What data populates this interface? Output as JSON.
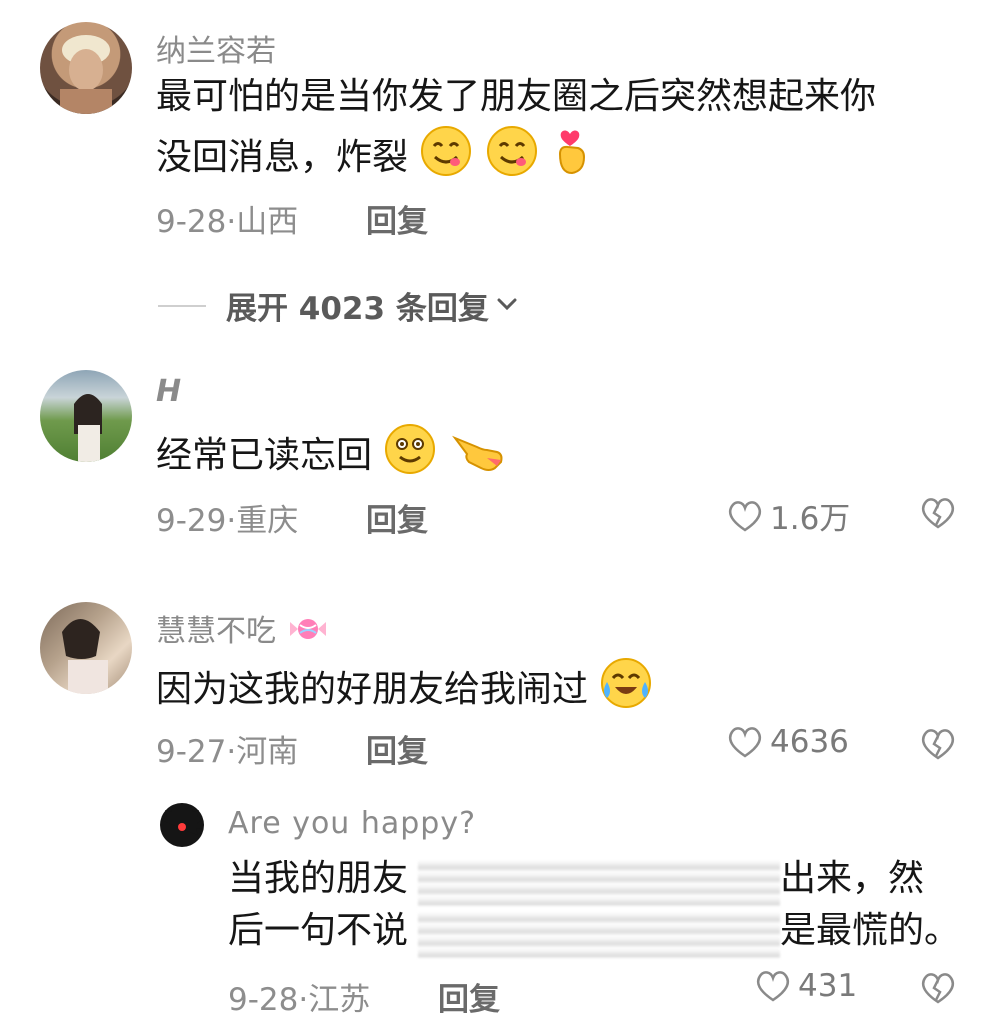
{
  "comments": [
    {
      "username": "纳兰容若",
      "text_line1": "最可怕的是当你发了朋友圈之后突然想起来你",
      "text_line2": "没回消息，炸裂",
      "date": "9-28",
      "location": "山西",
      "reply_label": "回复",
      "emojis": [
        "yum-face-emoji",
        "yum-face-emoji",
        "finger-heart-emoji"
      ]
    },
    {
      "username": "H",
      "text": "经常已读忘回",
      "date": "9-29",
      "location": "重庆",
      "reply_label": "回复",
      "likes": "1.6万",
      "emojis": [
        "smile-face-emoji",
        "pointing-hand-emoji"
      ]
    },
    {
      "username": "慧慧不吃",
      "text": "因为这我的好朋友给我闹过",
      "date": "9-27",
      "location": "河南",
      "reply_label": "回复",
      "likes": "4636",
      "emojis": [
        "candy-emoji",
        "tears-of-joy-emoji"
      ]
    }
  ],
  "expand_replies": "展开 4023 条回复",
  "sub_reply": {
    "username": "Are you happy?",
    "line1_start": "当我的朋友",
    "line1_end": "出来，然",
    "line2_start": "后一句不说",
    "line2_end": "是最慌的。",
    "date": "9-28",
    "location": "江苏",
    "reply_label": "回复",
    "likes": "431"
  }
}
